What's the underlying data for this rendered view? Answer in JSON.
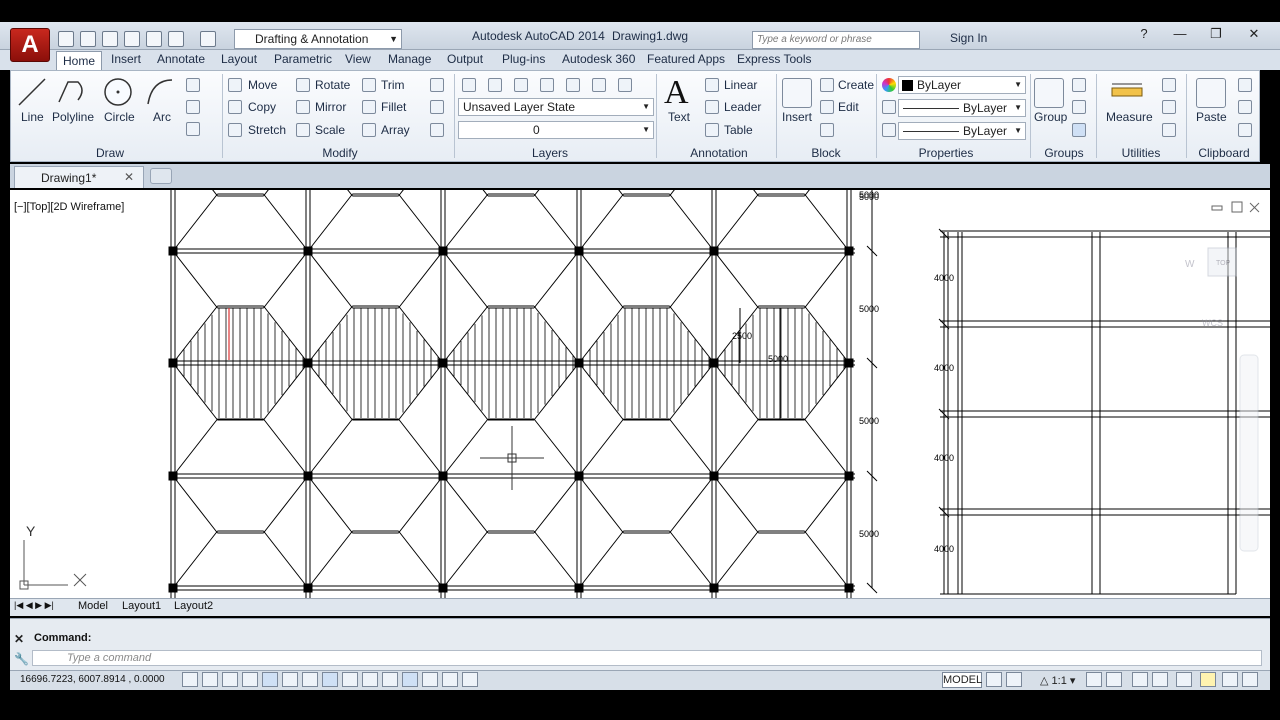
{
  "title_bar": {
    "app_button": "A",
    "workspace": "Drafting & Annotation",
    "app_title": "Autodesk AutoCAD 2014",
    "file_name": "Drawing1.dwg",
    "search_placeholder": "Type a keyword or phrase",
    "sign_in": "Sign In"
  },
  "ribbon_tabs": [
    "Home",
    "Insert",
    "Annotate",
    "Layout",
    "Parametric",
    "View",
    "Manage",
    "Output",
    "Plug-ins",
    "Autodesk 360",
    "Featured Apps",
    "Express Tools"
  ],
  "draw": {
    "line": "Line",
    "polyline": "Polyline",
    "circle": "Circle",
    "arc": "Arc",
    "panel": "Draw"
  },
  "modify": {
    "move": "Move",
    "rotate": "Rotate",
    "trim": "Trim",
    "copy": "Copy",
    "mirror": "Mirror",
    "fillet": "Fillet",
    "stretch": "Stretch",
    "scale": "Scale",
    "array": "Array",
    "panel": "Modify"
  },
  "layers": {
    "state": "Unsaved Layer State",
    "current": "0",
    "panel": "Layers"
  },
  "annotation": {
    "text": "Text",
    "linear": "Linear",
    "leader": "Leader",
    "table": "Table",
    "panel": "Annotation"
  },
  "block": {
    "insert": "Insert",
    "create": "Create",
    "edit": "Edit",
    "panel": "Block"
  },
  "properties": {
    "color": "ByLayer",
    "linetype": "ByLayer",
    "lineweight": "ByLayer",
    "panel": "Properties"
  },
  "groups": {
    "group": "Group",
    "panel": "Groups"
  },
  "utilities": {
    "measure": "Measure",
    "panel": "Utilities"
  },
  "clipboard": {
    "paste": "Paste",
    "panel": "Clipboard"
  },
  "document_tab": "Drawing1*",
  "viewport_label": "[−][Top][2D Wireframe]",
  "drawing": {
    "dimensions_main": [
      "5000",
      "5000",
      "5000",
      "5000",
      "5000"
    ],
    "dim_small": "2500",
    "dim_mid": "5000",
    "dimensions_side": [
      "4000",
      "4000",
      "4000",
      "4000"
    ],
    "ucs_y": "Y",
    "viewcube_top": "TOP",
    "viewcube_w": "W",
    "wcs": "WCS"
  },
  "layout_tabs": [
    "Model",
    "Layout1",
    "Layout2"
  ],
  "command": {
    "label": "Command:",
    "placeholder": "Type a command"
  },
  "status": {
    "coordinates": "16696.7223, 6007.8914 , 0.0000",
    "model": "MODEL",
    "scale": "1:1"
  }
}
